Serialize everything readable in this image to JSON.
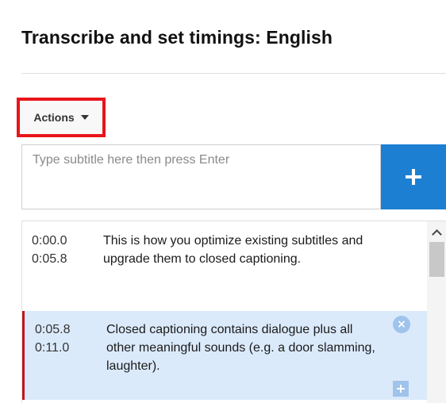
{
  "header": {
    "title": "Transcribe and set timings: English"
  },
  "toolbar": {
    "actions_label": "Actions"
  },
  "subtitle_input": {
    "placeholder": "Type subtitle here then press Enter",
    "value": "",
    "add_button_icon": "plus-icon"
  },
  "cues": [
    {
      "start": "0:00.0",
      "end": "0:05.8",
      "text": "This is how you optimize existing subtitles and upgrade them to closed captioning."
    },
    {
      "start": "0:05.8",
      "end": "0:11.0",
      "text": "Closed captioning contains dialogue plus all other meaningful sounds (e.g. a door slamming, laughter).",
      "selected": true,
      "delete_icon": "close-circle-icon",
      "insert_icon": "plus-icon"
    }
  ],
  "colors": {
    "accent_blue": "#1c7fd1",
    "highlight_red": "#e8151a",
    "selected_cue_bg": "#dbeafb",
    "selected_cue_border": "#c0151b"
  }
}
